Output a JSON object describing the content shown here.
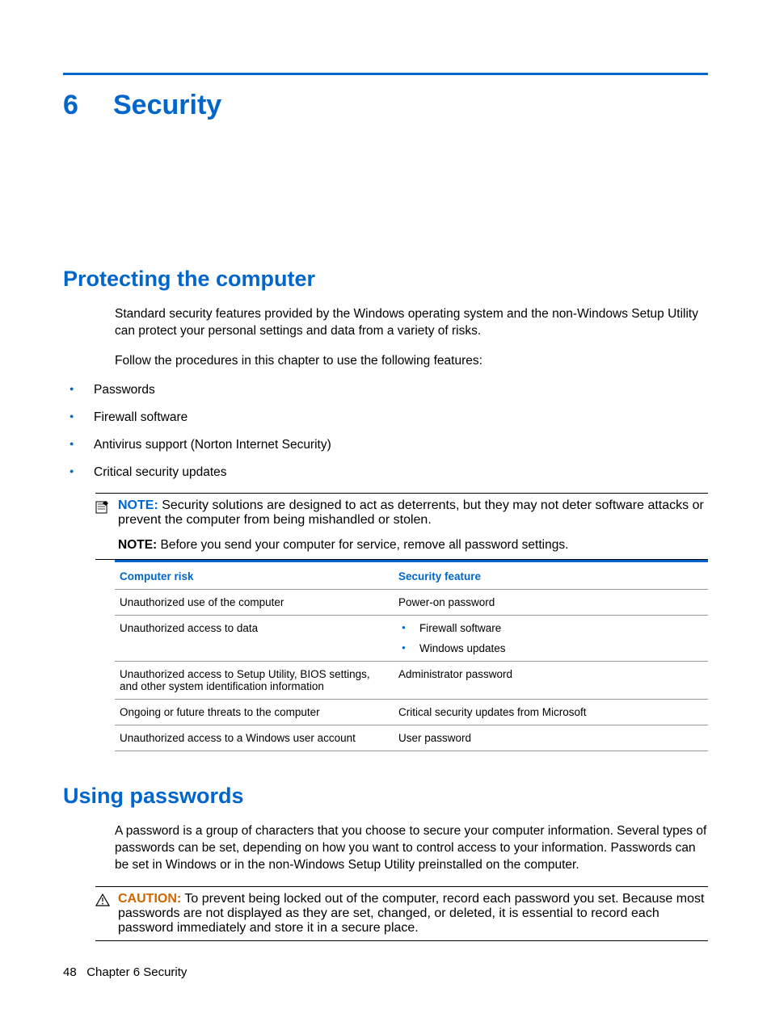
{
  "chapter": {
    "number": "6",
    "title": "Security"
  },
  "section1": {
    "heading": "Protecting the computer",
    "p1": "Standard security features provided by the Windows operating system and the non-Windows Setup Utility can protect your personal settings and data from a variety of risks.",
    "p2": "Follow the procedures in this chapter to use the following features:",
    "bullets": [
      "Passwords",
      "Firewall software",
      "Antivirus support (Norton Internet Security)",
      "Critical security updates"
    ],
    "note1": {
      "label": "NOTE:",
      "text": "Security solutions are designed to act as deterrents, but they may not deter software attacks or prevent the computer from being mishandled or stolen."
    },
    "note2": {
      "label": "NOTE:",
      "text": "Before you send your computer for service, remove all password settings."
    },
    "table": {
      "headers": [
        "Computer risk",
        "Security feature"
      ],
      "rows": [
        {
          "risk": "Unauthorized use of the computer",
          "feature": "Power-on password"
        },
        {
          "risk": "Unauthorized access to data",
          "feature_list": [
            "Firewall software",
            "Windows updates"
          ]
        },
        {
          "risk": "Unauthorized access to Setup Utility, BIOS settings, and other system identification information",
          "feature": "Administrator password"
        },
        {
          "risk": "Ongoing or future threats to the computer",
          "feature": "Critical security updates from Microsoft"
        },
        {
          "risk": "Unauthorized access to a Windows user account",
          "feature": "User password"
        }
      ]
    }
  },
  "section2": {
    "heading": "Using passwords",
    "p1": "A password is a group of characters that you choose to secure your computer information. Several types of passwords can be set, depending on how you want to control access to your information. Passwords can be set in Windows or in the non-Windows Setup Utility preinstalled on the computer.",
    "caution": {
      "label": "CAUTION:",
      "text": "To prevent being locked out of the computer, record each password you set. Because most passwords are not displayed as they are set, changed, or deleted, it is essential to record each password immediately and store it in a secure place."
    }
  },
  "footer": {
    "page": "48",
    "text": "Chapter 6   Security"
  }
}
